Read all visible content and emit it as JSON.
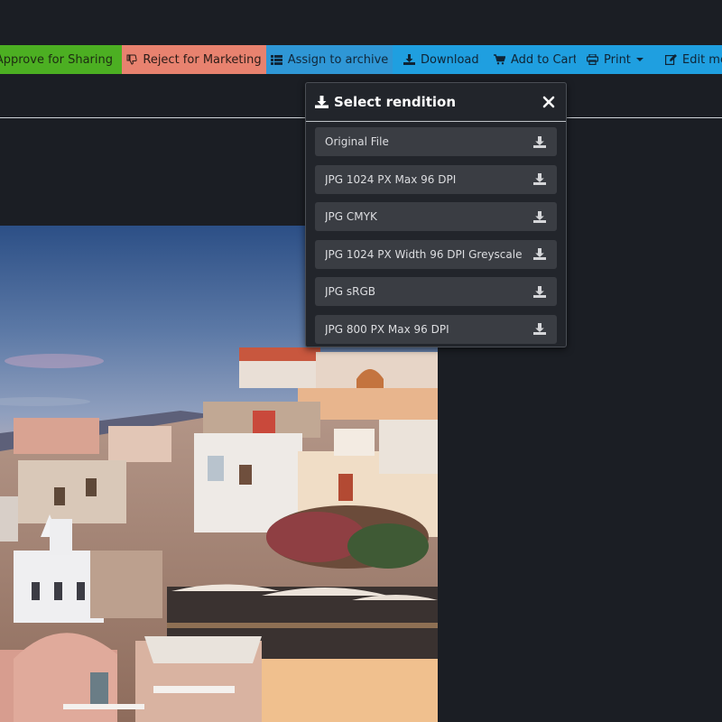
{
  "toolbar": {
    "approve_label": "Approve for Sharing",
    "reject_label": "Reject for Marketing",
    "archive_label": "Assign to archive",
    "download_label": "Download",
    "cart_label": "Add to Cart",
    "print_label": "Print",
    "edit_label": "Edit me"
  },
  "popup": {
    "title": "Select rendition",
    "renditions": [
      {
        "label": "Original File"
      },
      {
        "label": "JPG 1024 PX Max 96 DPI"
      },
      {
        "label": "JPG CMYK"
      },
      {
        "label": "JPG 1024 PX Width 96 DPI Greyscale"
      },
      {
        "label": "JPG sRGB"
      },
      {
        "label": "JPG 800 PX Max 96 DPI"
      }
    ]
  },
  "icons": {
    "approve": "thumbs-up-icon",
    "reject": "thumbs-down-icon",
    "archive": "list-icon",
    "download": "download-icon",
    "cart": "cart-icon",
    "print": "printer-icon",
    "edit": "edit-icon",
    "close": "close-icon"
  },
  "colors": {
    "approve": "#4caf22",
    "reject": "#e8826f",
    "archive": "#2f97d6",
    "primary": "#1f9fe0",
    "background": "#1b1e24",
    "popup_bg": "#22252b",
    "item_bg": "#3a3d43"
  }
}
